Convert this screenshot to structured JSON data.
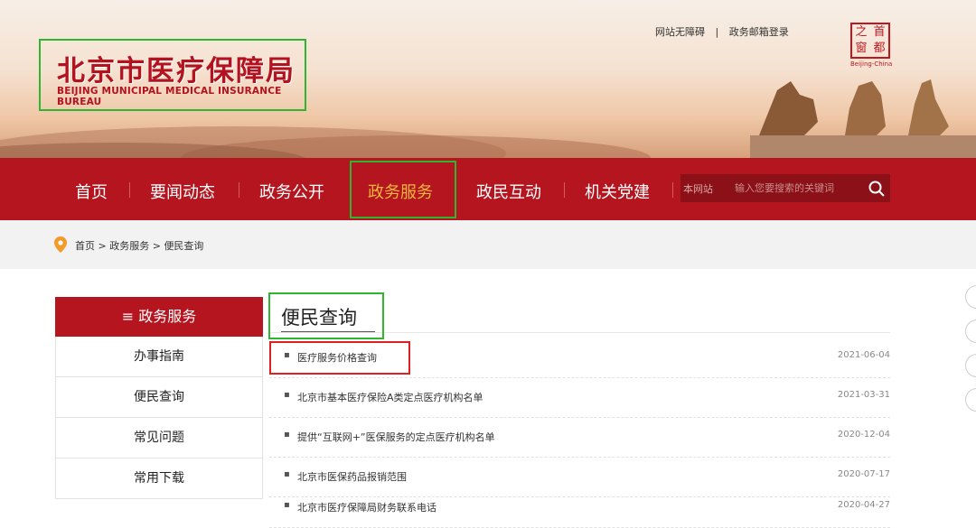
{
  "header": {
    "logo_cn": "北京市医疗保障局",
    "logo_en": "BEIJING MUNICIPAL MEDICAL INSURANCE BUREAU",
    "links": [
      "网站无障碍",
      "政务邮箱登录"
    ],
    "separator": "|",
    "seal_chars": [
      "之",
      "首",
      "窗",
      "都"
    ],
    "seal_en": "Beijing-China"
  },
  "nav": {
    "items": [
      "首页",
      "要闻动态",
      "政务公开",
      "政务服务",
      "政民互动",
      "机关党建"
    ],
    "active_index": 3,
    "search_scope": "本网站",
    "search_placeholder": "输入您要搜索的关键词"
  },
  "breadcrumb": {
    "items": [
      "首页",
      "政务服务",
      "便民查询"
    ],
    "separator": " > "
  },
  "sidebar": {
    "title": "≡ 政务服务",
    "items": [
      "办事指南",
      "便民查询",
      "常见问题",
      "常用下载"
    ]
  },
  "main": {
    "title": "便民查询",
    "rows": [
      {
        "title": "医疗服务价格查询",
        "date": "2021-06-04"
      },
      {
        "title": "北京市基本医疗保险A类定点医疗机构名单",
        "date": "2021-03-31"
      },
      {
        "title": "提供“互联网+”医保服务的定点医疗机构名单",
        "date": "2020-12-04"
      },
      {
        "title": "北京市医保药品报销范围",
        "date": "2020-07-17"
      },
      {
        "title": "北京市医疗保障局财务联系电话",
        "date": "2020-04-27"
      }
    ]
  },
  "colors": {
    "brand_red": "#b4151f",
    "nav_active": "#f4b63f",
    "highlight_green": "#2fb52f",
    "highlight_red": "#e02020"
  },
  "icons": [
    "map-pin-icon",
    "search-icon"
  ]
}
